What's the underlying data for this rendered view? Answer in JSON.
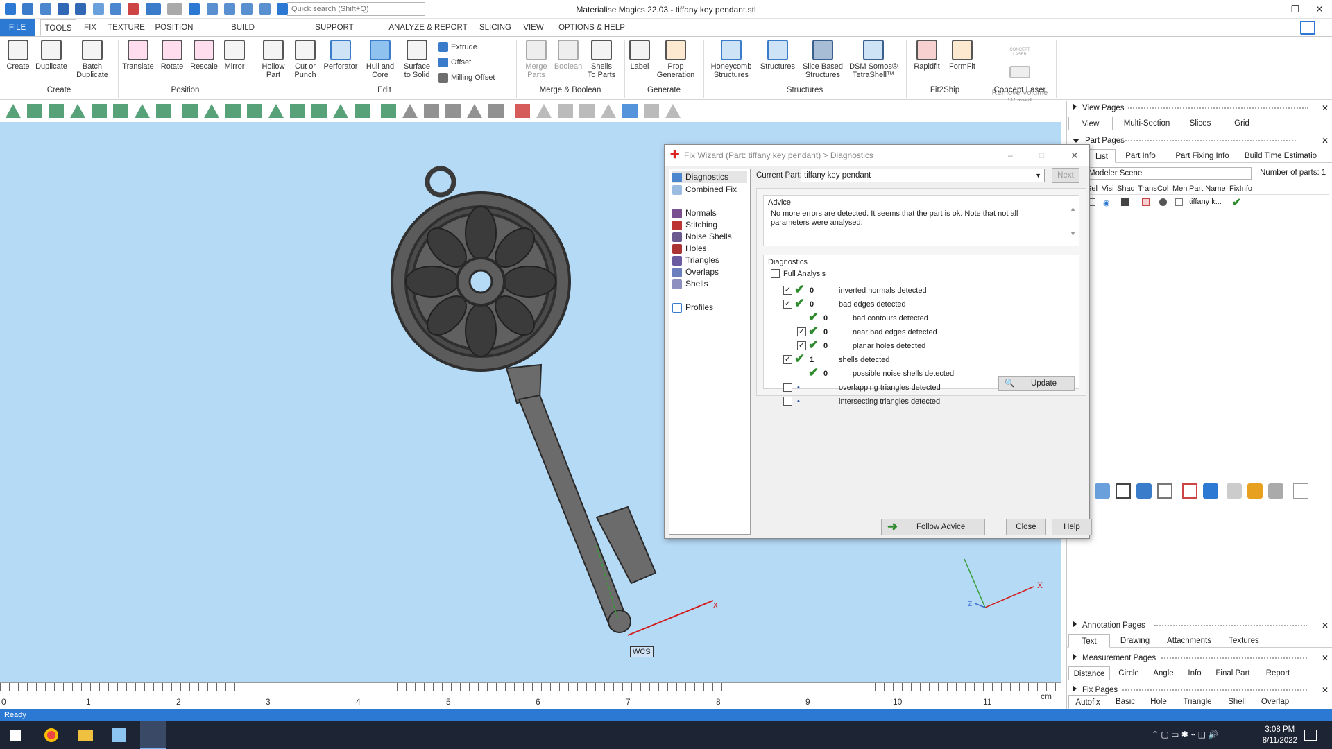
{
  "app": {
    "title": "Materialise Magics 22.03 - tiffany key pendant.stl",
    "quick_search_placeholder": "Quick search (Shift+Q)"
  },
  "ribbon_tabs": [
    "FILE",
    "TOOLS",
    "FIX",
    "TEXTURE",
    "POSITION",
    "BUILD PREPARATION",
    "SUPPORT GENERATION",
    "ANALYZE & REPORT",
    "SLICING",
    "VIEW",
    "OPTIONS & HELP"
  ],
  "ribbon": {
    "create": {
      "group": "Create",
      "buttons": [
        "Create",
        "Duplicate",
        "Batch\nDuplicate"
      ]
    },
    "position": {
      "group": "Position",
      "buttons": [
        "Translate",
        "Rotate",
        "Rescale",
        "Mirror"
      ]
    },
    "edit": {
      "group": "Edit",
      "buttons": [
        "Hollow\nPart",
        "Cut or\nPunch",
        "Perforator",
        "Hull and\nCore",
        "Surface\nto Solid"
      ],
      "small": [
        "Extrude",
        "Offset",
        "Milling Offset"
      ]
    },
    "merge": {
      "group": "Merge & Boolean",
      "buttons": [
        "Merge\nParts",
        "Boolean",
        "Shells\nTo Parts"
      ]
    },
    "generate": {
      "group": "Generate",
      "buttons": [
        "Label",
        "Prop\nGeneration"
      ]
    },
    "structures": {
      "group": "Structures",
      "buttons": [
        "Honeycomb\nStructures",
        "Structures",
        "Slice Based\nStructures",
        "DSM Somos®\nTetraShell™"
      ]
    },
    "fit2ship": {
      "group": "Fit2Ship",
      "buttons": [
        "Rapidfit",
        "FormFit"
      ]
    },
    "concept": {
      "group": "Concept Laser",
      "buttons": [
        "Remove Volume\nWizard"
      ],
      "logo_text": "CONCEPT LASER"
    }
  },
  "viewport": {
    "axis_x": "x",
    "wcs": "WCS",
    "triad_x": "X",
    "triad_z": "Z"
  },
  "ruler": {
    "labels": [
      "0",
      "1",
      "2",
      "3",
      "4",
      "5",
      "6",
      "7",
      "8",
      "9",
      "10",
      "11"
    ],
    "unit": "cm"
  },
  "status": "Ready",
  "right_panel": {
    "view_pages": {
      "title": "View Pages",
      "tabs": [
        "View",
        "Multi-Section",
        "Slices",
        "Grid"
      ]
    },
    "part_pages": {
      "title": "Part Pages",
      "tabs": [
        "List",
        "Part Info",
        "Part Fixing Info",
        "Build Time Estimatio"
      ],
      "scene": "Modeler Scene",
      "parts_label": "Number of parts: 1",
      "columns": [
        "Sel",
        "Visi",
        "Shad",
        "Trans",
        "Col",
        "Men",
        "Part Name",
        "FixInfo"
      ],
      "row": {
        "name": "tiffany k..."
      }
    },
    "annotation_pages": {
      "title": "Annotation Pages",
      "tabs": [
        "Text",
        "Drawing",
        "Attachments",
        "Textures"
      ]
    },
    "measurement_pages": {
      "title": "Measurement Pages",
      "tabs": [
        "Distance",
        "Circle",
        "Angle",
        "Info",
        "Final Part",
        "Report"
      ]
    },
    "fix_pages": {
      "title": "Fix Pages",
      "tabs": [
        "Autofix",
        "Basic",
        "Hole",
        "Triangle",
        "Shell",
        "Overlap"
      ]
    }
  },
  "dialog": {
    "title": "Fix Wizard (Part: tiffany key pendant) > Diagnostics",
    "nav": [
      "Diagnostics",
      "Combined Fix",
      "Normals",
      "Stitching",
      "Noise Shells",
      "Holes",
      "Triangles",
      "Overlaps",
      "Shells",
      "Profiles"
    ],
    "current_part_label": "Current Part:",
    "current_part": "tiffany key pendant",
    "next": "Next",
    "advice_title": "Advice",
    "advice_text": "No more errors are detected. It seems that the part is ok. Note that not all parameters were analysed.",
    "diagnostics_title": "Diagnostics",
    "full_analysis": "Full Analysis",
    "rows": [
      {
        "checkbox": true,
        "checked": true,
        "status": "ok",
        "count": "0",
        "label": "inverted normals detected",
        "indent": 0
      },
      {
        "checkbox": true,
        "checked": true,
        "status": "ok",
        "count": "0",
        "label": "bad edges detected",
        "indent": 0
      },
      {
        "checkbox": false,
        "checked": false,
        "status": "ok",
        "count": "0",
        "label": "bad contours detected",
        "indent": 1
      },
      {
        "checkbox": true,
        "checked": true,
        "status": "ok",
        "count": "0",
        "label": "near bad edges detected",
        "indent": 1
      },
      {
        "checkbox": true,
        "checked": true,
        "status": "ok",
        "count": "0",
        "label": "planar holes detected",
        "indent": 1
      },
      {
        "checkbox": true,
        "checked": true,
        "status": "ok",
        "count": "1",
        "label": "shells detected",
        "indent": 0
      },
      {
        "checkbox": false,
        "checked": false,
        "status": "ok",
        "count": "0",
        "label": "possible noise shells detected",
        "indent": 1
      },
      {
        "checkbox": true,
        "checked": false,
        "status": "dot",
        "count": "",
        "label": "overlapping triangles detected",
        "indent": 0
      },
      {
        "checkbox": true,
        "checked": false,
        "status": "dot",
        "count": "",
        "label": "intersecting triangles detected",
        "indent": 0
      }
    ],
    "update": "Update",
    "follow_advice": "Follow Advice",
    "close": "Close",
    "help": "Help"
  },
  "taskbar": {
    "time": "3:08 PM",
    "date": "8/11/2022"
  },
  "colors": {
    "accent": "#2b79d2",
    "viewport": "#b5daf6",
    "ok": "#2d8a2d"
  }
}
